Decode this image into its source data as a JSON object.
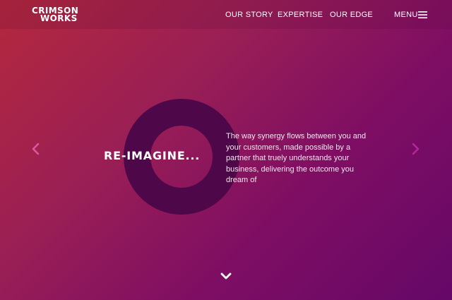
{
  "brand": {
    "line1": "CRIMSON",
    "line2": "WORKS"
  },
  "nav": {
    "our_story": "OUR STORY",
    "expertise": "EXPERTISE",
    "our_edge": "OUR EDGE",
    "menu": "MENU"
  },
  "hero": {
    "headline": "RE-IMAGINE...",
    "body": "The way synergy flows between you and your customers, made possible by a partner that truely understands your business, delivering the outcome you dream of"
  },
  "icons": {
    "menu": "hamburger-icon",
    "prev": "chevron-left-icon",
    "next": "chevron-right-icon",
    "scroll": "chevron-down-icon"
  },
  "colors": {
    "gradient_start": "#b4283d",
    "gradient_end": "#650868",
    "ring": "#4e0749",
    "arrow": "#e0559f",
    "text": "#ffffff"
  }
}
